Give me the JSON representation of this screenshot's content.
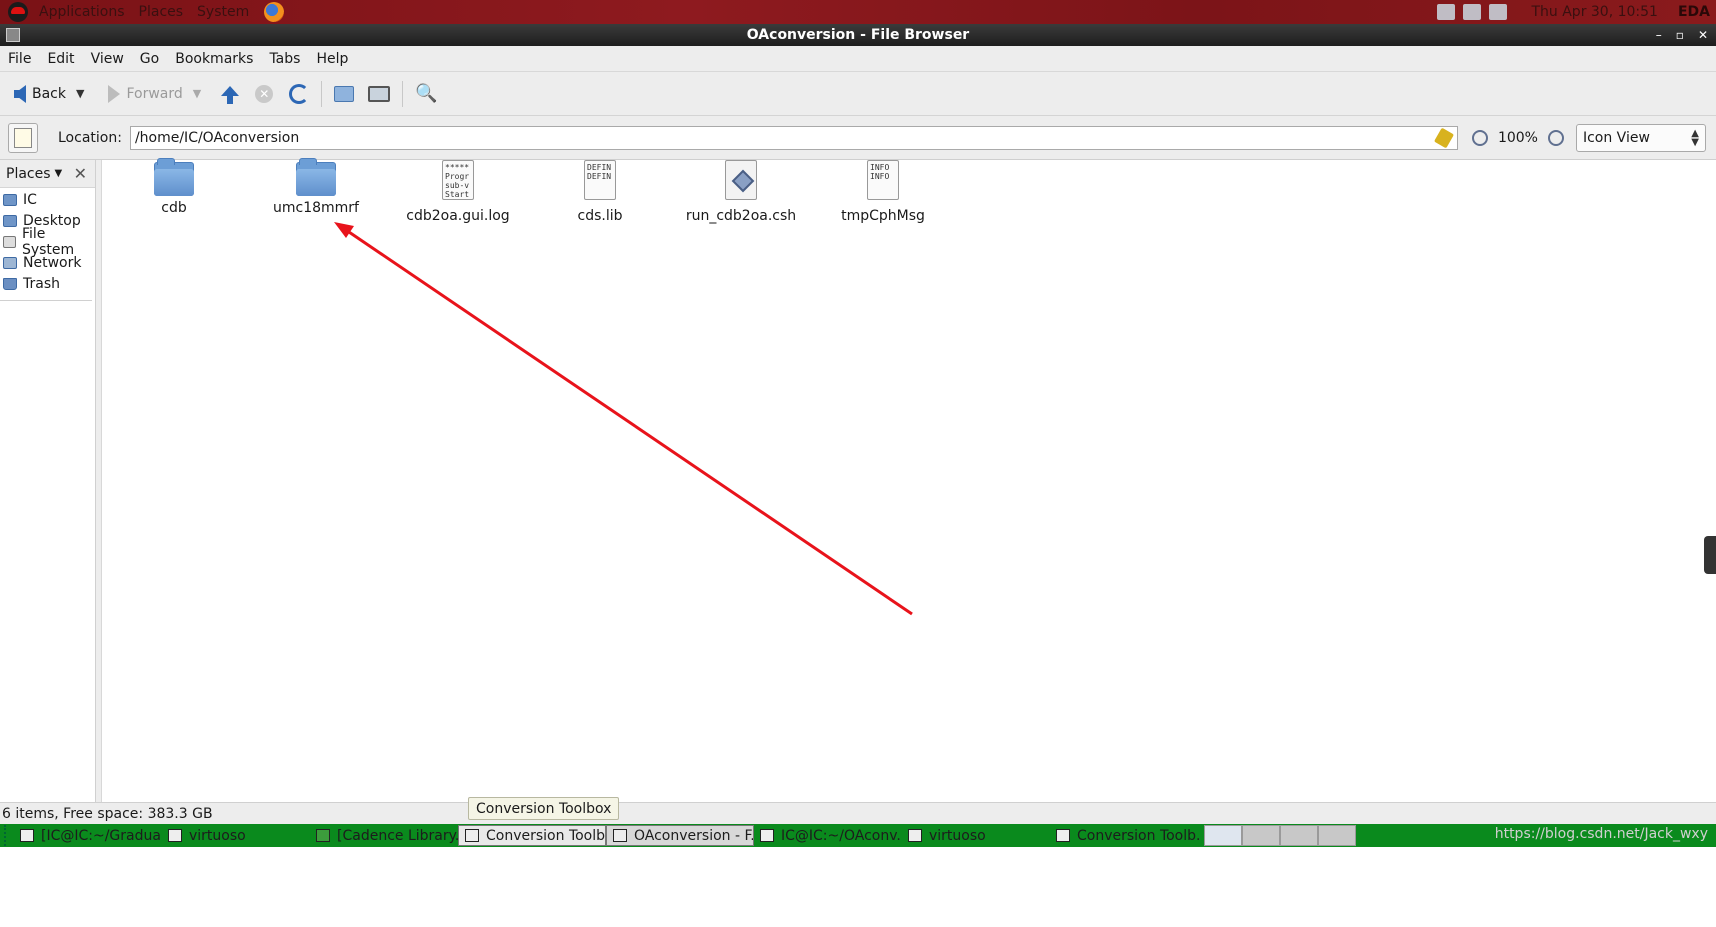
{
  "top_panel": {
    "menus": [
      "Applications",
      "Places",
      "System"
    ],
    "clock": "Thu Apr 30, 10:51",
    "user": "EDA"
  },
  "window": {
    "title": "OAconversion - File Browser"
  },
  "menubar": [
    "File",
    "Edit",
    "View",
    "Go",
    "Bookmarks",
    "Tabs",
    "Help"
  ],
  "toolbar": {
    "back_label": "Back",
    "forward_label": "Forward"
  },
  "location": {
    "label": "Location:",
    "path": "/home/IC/OAconversion",
    "zoom": "100%",
    "view_mode": "Icon View"
  },
  "sidebar": {
    "header": "Places",
    "items": [
      "IC",
      "Desktop",
      "File System",
      "Network",
      "Trash"
    ]
  },
  "files": [
    {
      "name": "cdb",
      "type": "folder"
    },
    {
      "name": "umc18mmrf",
      "type": "folder"
    },
    {
      "name": "cdb2oa.gui.log",
      "type": "text",
      "preview": "*****\nProgr\nsub-v\nStart"
    },
    {
      "name": "cds.lib",
      "type": "text",
      "preview": "DEFIN\nDEFIN"
    },
    {
      "name": "run_cdb2oa.csh",
      "type": "script"
    },
    {
      "name": "tmpCphMsg",
      "type": "text",
      "preview": "INFO\nINFO"
    }
  ],
  "status": {
    "text": "6 items, Free space: 383.3 GB",
    "tooltip": "Conversion Toolbox"
  },
  "taskbar": {
    "tasks": [
      "[IC@IC:~/Gradua...",
      "virtuoso",
      "[Cadence Library...",
      "Conversion Toolb...",
      "OAconversion - F...",
      "IC@IC:~/OAconv...",
      "virtuoso",
      "Conversion Toolb..."
    ],
    "watermark": "https://blog.csdn.net/Jack_wxy"
  },
  "colors": {
    "panel_red": "#8e1a1f",
    "taskbar_green": "#0a8a1d",
    "annotation_arrow": "#e8131b",
    "folder_blue": "#6c9ed6"
  }
}
